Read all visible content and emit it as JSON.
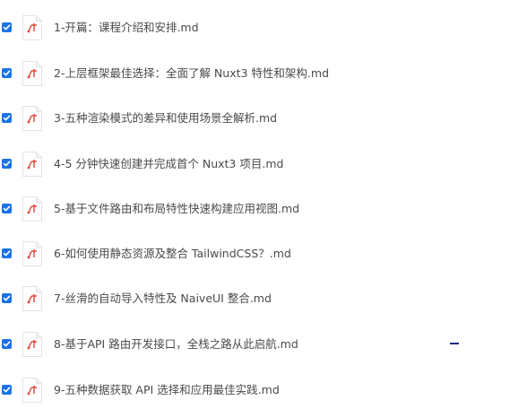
{
  "files": [
    {
      "name": "1-开篇：课程介绍和安排.md",
      "checked": true
    },
    {
      "name": "2-上层框架最佳选择：全面了解 Nuxt3 特性和架构.md",
      "checked": true
    },
    {
      "name": "3-五种渲染模式的差异和使用场景全解析.md",
      "checked": true
    },
    {
      "name": "4-5 分钟快速创建并完成首个 Nuxt3 项目.md",
      "checked": true
    },
    {
      "name": "5-基于文件路由和布局特性快速构建应用视图.md",
      "checked": true
    },
    {
      "name": "6-如何使用静态资源及整合 TailwindCSS？.md",
      "checked": true
    },
    {
      "name": "7-丝滑的自动导入特性及 NaiveUI 整合.md",
      "checked": true
    },
    {
      "name": "8-基于API 路由开发接口，全栈之路从此启航.md",
      "checked": true
    },
    {
      "name": "9-五种数据获取 API 选择和应用最佳实践.md",
      "checked": true
    }
  ],
  "icons": {
    "checkbox": "checkmark-icon",
    "file": "markdown-file-icon"
  },
  "colors": {
    "checkbox": "#1a73e8",
    "icon_accent": "#e0443a",
    "text": "#4a4a4a",
    "minus_indicator": "#1a2a8a"
  }
}
